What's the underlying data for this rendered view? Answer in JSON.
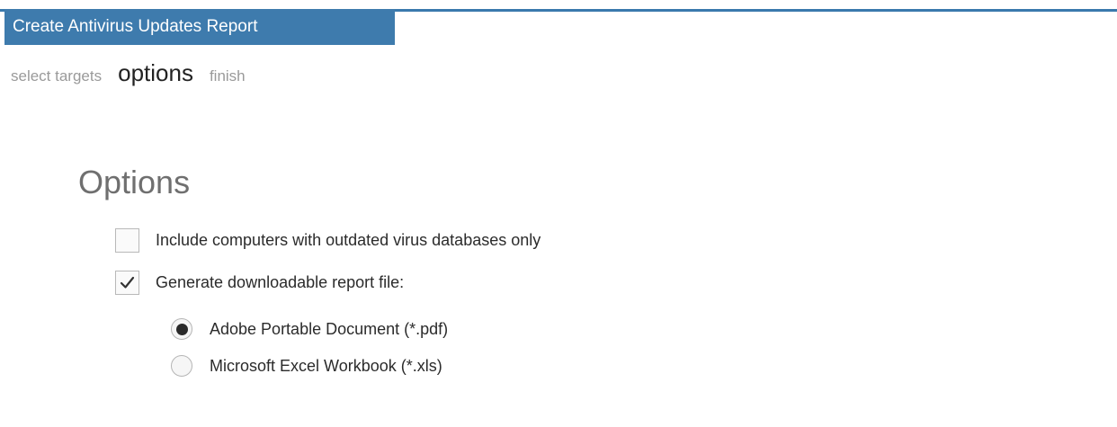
{
  "window": {
    "title": "Create Antivirus Updates Report"
  },
  "wizard": {
    "steps": [
      {
        "label": "select targets",
        "state": "inactive"
      },
      {
        "label": "options",
        "state": "active"
      },
      {
        "label": "finish",
        "state": "inactive"
      }
    ]
  },
  "options": {
    "heading": "Options",
    "outdated_only": {
      "label": "Include computers with outdated virus databases only",
      "checked": false
    },
    "generate_file": {
      "label": "Generate downloadable report file:",
      "checked": true
    },
    "formats": [
      {
        "label": "Adobe Portable Document (*.pdf)",
        "selected": true
      },
      {
        "label": "Microsoft Excel Workbook (*.xls)",
        "selected": false
      }
    ]
  },
  "colors": {
    "accent": "#3e7bad"
  },
  "icons": {
    "checked": "checkmark-icon",
    "radio_selected": "radio-dot-icon"
  }
}
